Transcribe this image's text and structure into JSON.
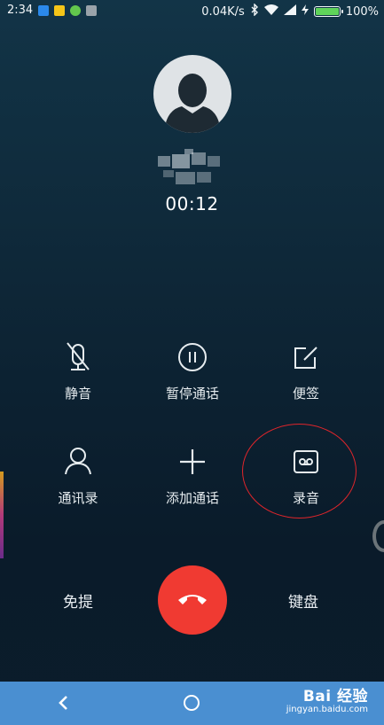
{
  "status_bar": {
    "time": "2:34",
    "net_speed": "0.04K/s",
    "battery": "100%",
    "battery_level": 1.0,
    "notification_icons": [
      "download-icon",
      "message-icon",
      "android-icon",
      "media-icon"
    ]
  },
  "call": {
    "duration": "00:12"
  },
  "controls": [
    {
      "label": "静音",
      "icon": "mute-mic-icon"
    },
    {
      "label": "暂停通话",
      "icon": "pause-icon"
    },
    {
      "label": "便签",
      "icon": "note-edit-icon"
    },
    {
      "label": "通讯录",
      "icon": "contacts-icon"
    },
    {
      "label": "添加通话",
      "icon": "add-call-icon"
    },
    {
      "label": "录音",
      "icon": "record-tape-icon"
    }
  ],
  "bottom": {
    "speaker_label": "免提",
    "keypad_label": "键盘",
    "end_call_icon": "end-call-icon"
  },
  "watermark": {
    "title": "Bai 经验",
    "url": "jingyan.baidu.com"
  },
  "colors": {
    "end_call": "#f03a32",
    "nav_bar": "#4a8fd1",
    "highlight_circle": "#e0252b"
  }
}
